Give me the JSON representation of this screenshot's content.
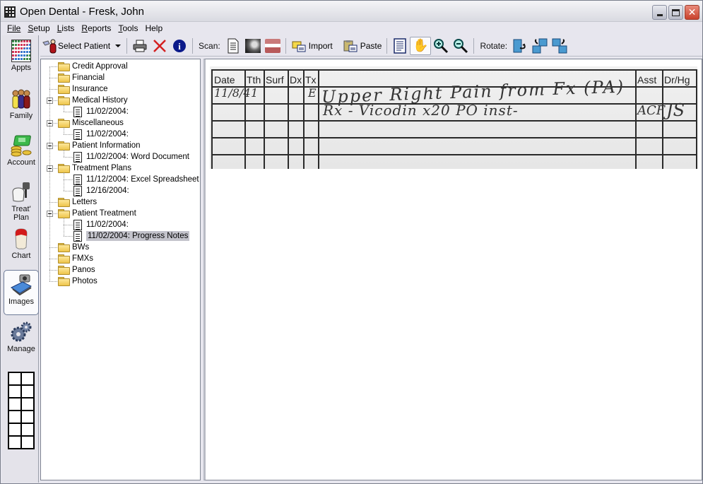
{
  "window": {
    "title": "Open Dental - Fresk, John",
    "controls": [
      "minimize",
      "maximize",
      "close"
    ]
  },
  "menu": [
    {
      "label": "File",
      "accel": "F"
    },
    {
      "label": "Setup",
      "accel": "S"
    },
    {
      "label": "Lists",
      "accel": "L"
    },
    {
      "label": "Reports",
      "accel": "R"
    },
    {
      "label": "Tools",
      "accel": "T"
    },
    {
      "label": "Help",
      "accel": ""
    }
  ],
  "modules": [
    {
      "label": "Appts",
      "icon": "appointments-icon"
    },
    {
      "label": "Family",
      "icon": "family-icon"
    },
    {
      "label": "Account",
      "icon": "account-money-icon"
    },
    {
      "label": "Treat' Plan",
      "icon": "treatment-plan-icon"
    },
    {
      "label": "Chart",
      "icon": "tooth-chart-icon"
    },
    {
      "label": "Images",
      "icon": "scanner-camera-icon",
      "active": true
    },
    {
      "label": "Manage",
      "icon": "gears-icon"
    }
  ],
  "toolbar": {
    "select_patient": "Select Patient",
    "scan_label": "Scan:",
    "import": "Import",
    "paste": "Paste",
    "rotate_label": "Rotate:"
  },
  "tree": [
    {
      "type": "folder",
      "label": "Credit Approval"
    },
    {
      "type": "folder",
      "label": "Financial"
    },
    {
      "type": "folder",
      "label": "Insurance"
    },
    {
      "type": "folder",
      "label": "Medical History",
      "expanded": true
    },
    {
      "type": "doc",
      "label": "11/02/2004:"
    },
    {
      "type": "folder",
      "label": "Miscellaneous",
      "expanded": true
    },
    {
      "type": "doc",
      "label": "11/02/2004:"
    },
    {
      "type": "folder",
      "label": "Patient Information",
      "expanded": true
    },
    {
      "type": "doc",
      "label": "11/02/2004: Word Document"
    },
    {
      "type": "folder",
      "label": "Treatment Plans",
      "expanded": true
    },
    {
      "type": "doc",
      "label": "11/12/2004: Excel Spreadsheet"
    },
    {
      "type": "doc",
      "label": "12/16/2004:"
    },
    {
      "type": "folder",
      "label": "Letters"
    },
    {
      "type": "folder",
      "label": "Patient Treatment",
      "expanded": true
    },
    {
      "type": "doc",
      "label": "11/02/2004:"
    },
    {
      "type": "doc",
      "label": "11/02/2004: Progress Notes",
      "selected": true
    },
    {
      "type": "folder",
      "label": "BWs"
    },
    {
      "type": "folder",
      "label": "FMXs"
    },
    {
      "type": "folder",
      "label": "Panos"
    },
    {
      "type": "folder",
      "label": "Photos"
    }
  ],
  "scanned_document": {
    "headers": [
      "Date",
      "Tth",
      "Surf",
      "Dx",
      "Tx",
      "",
      "Asst",
      "Dr/Hg"
    ],
    "handwriting": {
      "row1_date": "11/8/4",
      "row1_tooth": "1",
      "row1_tx": "E",
      "row1_notes": "Upper Right Pain from Fx (PA)",
      "row2_notes": "Rx - Vicodin x20 PO inst-",
      "row2_asst": "ACF",
      "row2_dr": "JS"
    }
  }
}
